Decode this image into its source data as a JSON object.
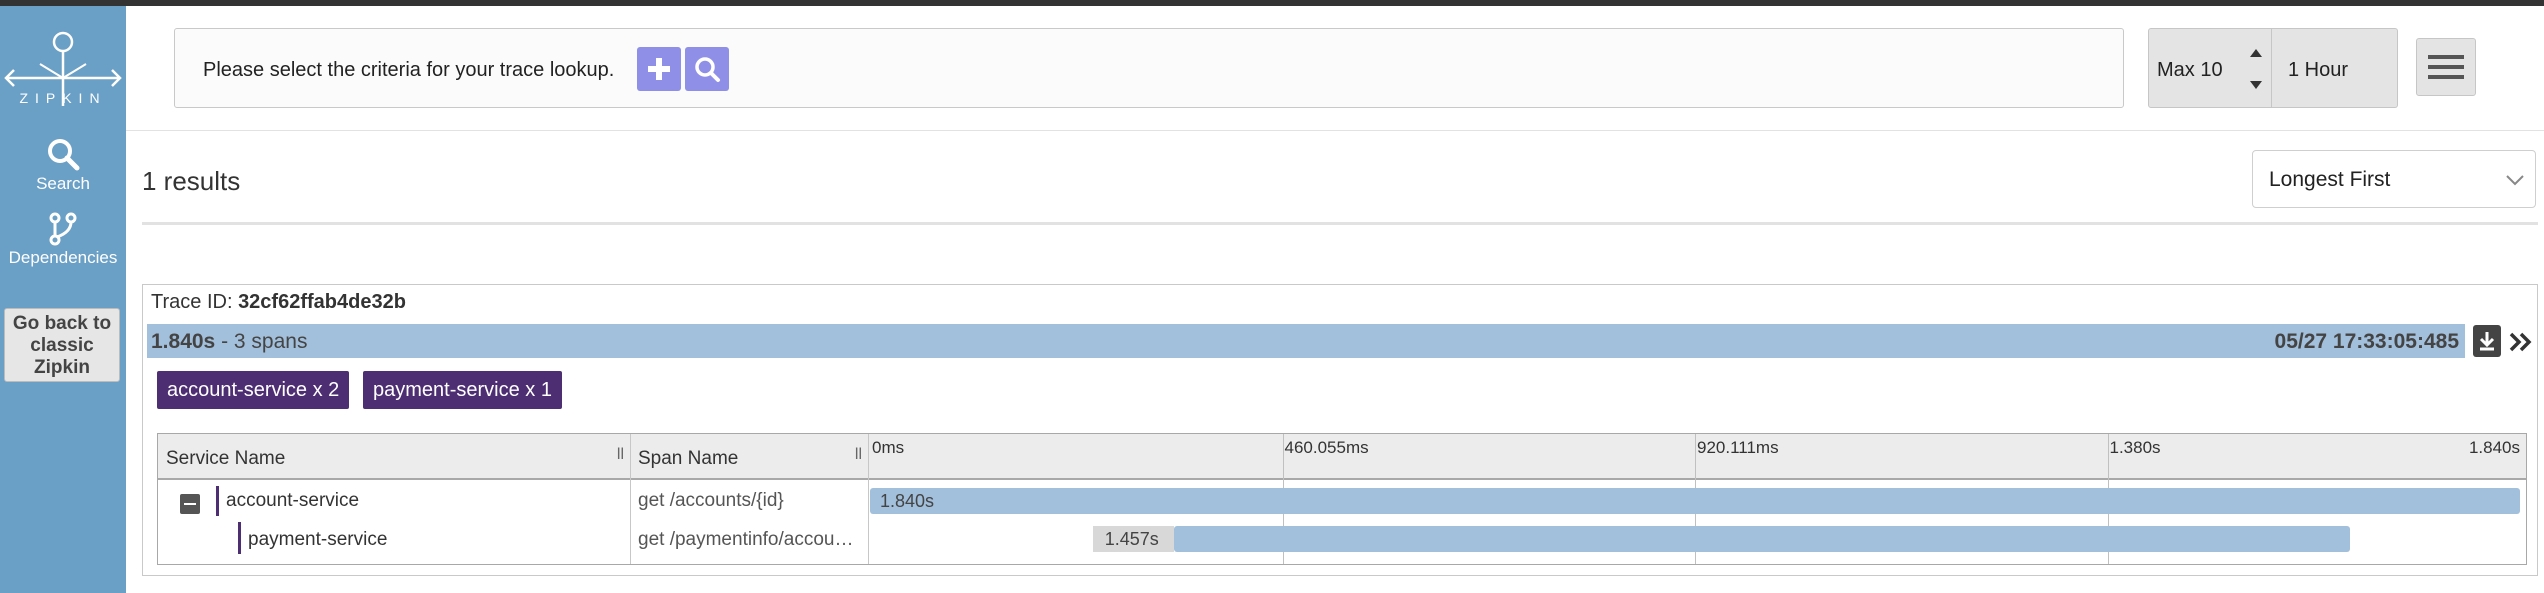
{
  "app": {
    "logo_text": "ZIPKIN",
    "colors": {
      "sidebar": "#6a9fc6",
      "accent_button": "#8f8fe8",
      "service_badge": "#4d2e73",
      "span_bar": "#a2bfdb"
    }
  },
  "sidebar": {
    "items": [
      {
        "label": "Search",
        "icon": "search-icon"
      },
      {
        "label": "Dependencies",
        "icon": "dependencies-icon"
      }
    ],
    "classic_button": "Go back to classic Zipkin"
  },
  "search": {
    "prompt": "Please select the criteria for your trace lookup.",
    "add_icon": "plus-icon",
    "search_icon": "search-icon",
    "limit": "Max 10",
    "lookback": "1 Hour",
    "menu_icon": "hamburger-icon"
  },
  "results": {
    "count_label": "1 results",
    "sort": "Longest First"
  },
  "trace": {
    "id_label": "Trace ID:",
    "id": "32cf62ffab4de32b",
    "duration": "1.840s",
    "spans_text": "- 3 spans",
    "timestamp": "05/27 17:33:05:485",
    "services": [
      {
        "label": "account-service x 2"
      },
      {
        "label": "payment-service x 1"
      }
    ],
    "table": {
      "headers": {
        "service": "Service Name",
        "span": "Span Name"
      },
      "ticks": [
        "0ms",
        "460.055ms",
        "920.111ms",
        "1.380s",
        "1.840s"
      ],
      "rows": [
        {
          "service": "account-service",
          "span": "get /accounts/{id}",
          "duration": "1.840s",
          "start_fraction": 0.0,
          "width_fraction": 1.0
        },
        {
          "service": "payment-service",
          "span": "get /paymentinfo/accoun…",
          "duration": "1.457s",
          "start_fraction": 0.184,
          "width_fraction": 0.713
        }
      ]
    }
  }
}
